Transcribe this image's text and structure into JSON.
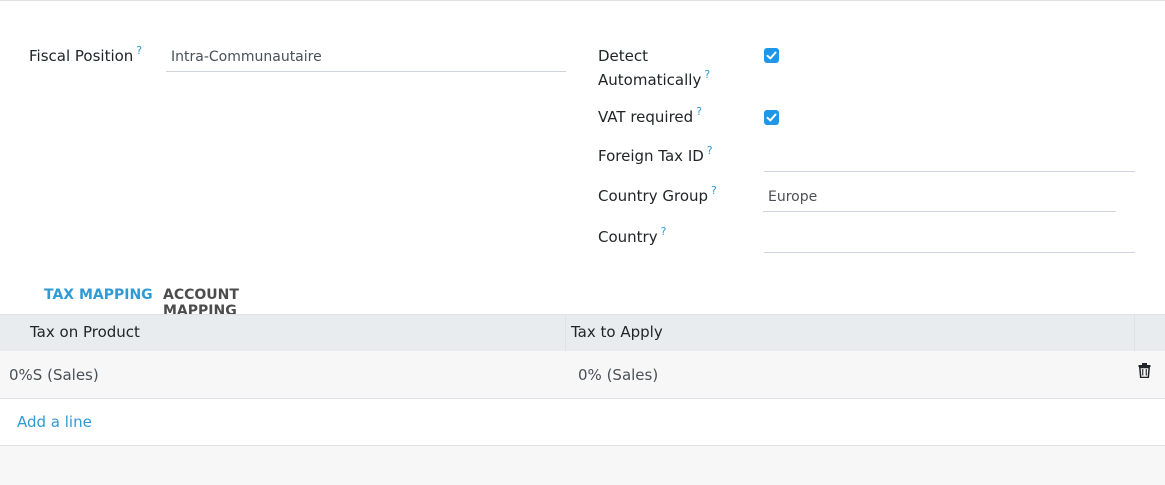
{
  "form": {
    "fiscal_position": {
      "label": "Fiscal Position",
      "help": "?",
      "value": "Intra-Communautaire"
    },
    "detect_automatically": {
      "label_line1": "Detect",
      "label_line2": "Automatically",
      "help": "?",
      "checked": true
    },
    "vat_required": {
      "label": "VAT required",
      "help": "?",
      "checked": true
    },
    "foreign_tax_id": {
      "label": "Foreign Tax ID",
      "help": "?",
      "value": ""
    },
    "country_group": {
      "label": "Country Group",
      "help": "?",
      "value": "Europe"
    },
    "country": {
      "label": "Country",
      "help": "?",
      "value": ""
    }
  },
  "tabs": [
    {
      "label": "TAX MAPPING",
      "active": true
    },
    {
      "label": "ACCOUNT MAPPING",
      "active": false
    }
  ],
  "table": {
    "columns": [
      "Tax on Product",
      "Tax to Apply"
    ],
    "rows": [
      {
        "tax_on_product": "0%S (Sales)",
        "tax_to_apply": "0% (Sales)"
      }
    ],
    "add_line": "Add a line"
  },
  "colors": {
    "accent": "#2f9bd4",
    "checkbox": "#1f97e8",
    "header_bg": "#e9ecef",
    "row_bg": "#f7f7f7"
  },
  "icons": {
    "checkbox": "checkmark-icon",
    "delete": "trash-icon"
  }
}
